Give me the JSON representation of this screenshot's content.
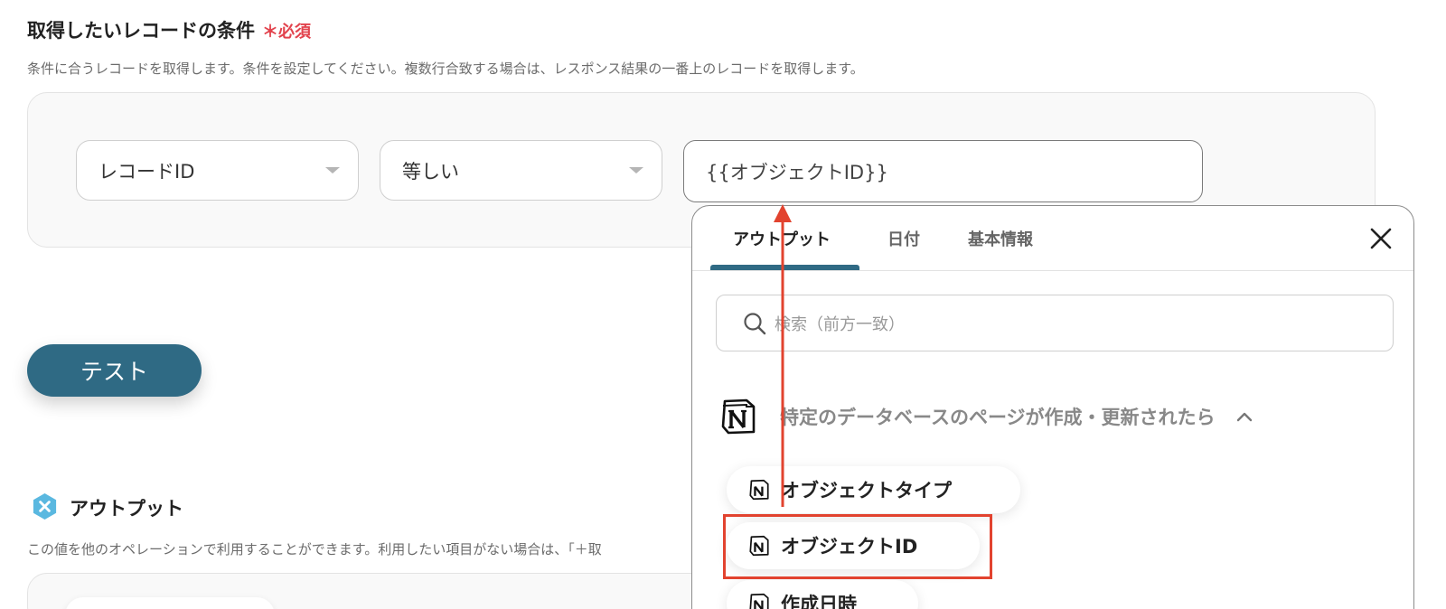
{
  "condition": {
    "title": "取得したいレコードの条件",
    "required_label": "＊必須",
    "description": "条件に合うレコードを取得します。条件を設定してください。複数行合致する場合は、レスポンス結果の一番上のレコードを取得します。",
    "field_select": "レコードID",
    "operator_select": "等しい",
    "value": "{{オブジェクトID}}"
  },
  "test_button": "テスト",
  "output": {
    "title": "アウトプット",
    "description": "この値を他のオペレーションで利用することができます。利用したい項目がない場合は、「＋取"
  },
  "panel": {
    "tabs": [
      "アウトプット",
      "日付",
      "基本情報"
    ],
    "active_tab": "アウトプット",
    "search_placeholder": "検索（前方一致）",
    "group_label": "特定のデータベースのページが作成・更新されたら",
    "items": [
      "オブジェクトタイプ",
      "オブジェクトID",
      "作成日時"
    ]
  },
  "colors": {
    "accent": "#2f6a84",
    "required": "#e2434d",
    "annotation": "#e2432f"
  },
  "icons": [
    "notion-icon",
    "search-icon",
    "close-icon",
    "chevron-up-icon",
    "output-badge-icon"
  ]
}
